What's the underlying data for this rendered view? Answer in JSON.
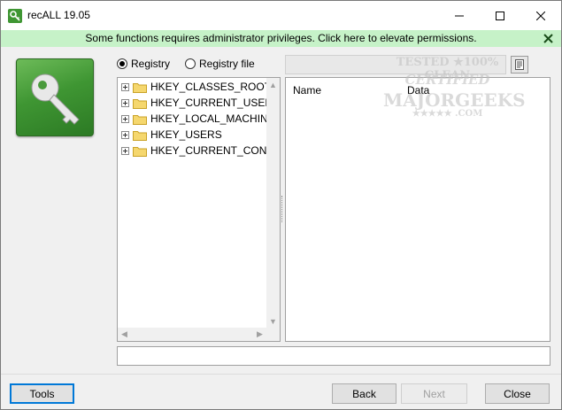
{
  "window": {
    "title": "recALL 19.05"
  },
  "banner": {
    "text": "Some functions requires administrator privileges. Click here to elevate permissions.",
    "color": "#c6f2c8"
  },
  "source": {
    "options": [
      {
        "label": "Registry",
        "checked": true
      },
      {
        "label": "Registry file",
        "checked": false
      }
    ],
    "path_value": ""
  },
  "tree": {
    "items": [
      {
        "label": "HKEY_CLASSES_ROOT"
      },
      {
        "label": "HKEY_CURRENT_USER"
      },
      {
        "label": "HKEY_LOCAL_MACHINE"
      },
      {
        "label": "HKEY_USERS"
      },
      {
        "label": "HKEY_CURRENT_CONFIG"
      }
    ]
  },
  "list": {
    "columns": [
      "Name",
      "Data"
    ]
  },
  "watermark": {
    "lines": [
      "TESTED ★100% CLEAN",
      "CERTIFIED",
      "MAJORGEEKS",
      "★★★★★ .COM"
    ]
  },
  "status": {
    "text": ""
  },
  "buttons": {
    "tools": "Tools",
    "back": "Back",
    "next": "Next",
    "close": "Close"
  },
  "colors": {
    "logo_green": "#3f9633",
    "focus_blue": "#0078d7"
  }
}
